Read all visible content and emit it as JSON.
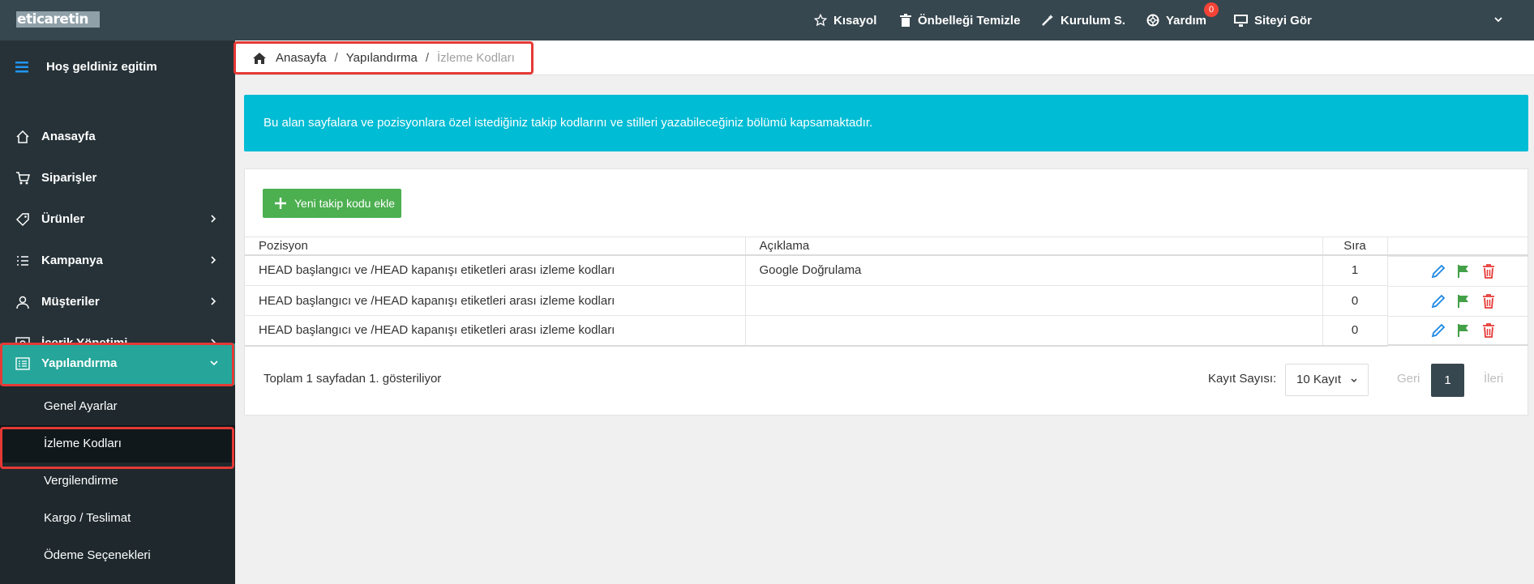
{
  "app": {
    "logo_text": "eticaretin"
  },
  "topbar": {
    "items": [
      {
        "label": "Kısayol",
        "icon": "star-icon"
      },
      {
        "label": "Önbelleği Temizle",
        "icon": "trash-icon"
      },
      {
        "label": "Kurulum S.",
        "icon": "magic-wand-icon"
      },
      {
        "label": "Yardım",
        "icon": "help-lifebuoy-icon",
        "badge": "0"
      },
      {
        "label": "Siteyi Gör",
        "icon": "monitor-icon"
      }
    ]
  },
  "sidebar": {
    "welcome": "Hoş geldiniz egitim",
    "items": [
      {
        "label": "Anasayfa",
        "icon": "home-icon"
      },
      {
        "label": "Siparişler",
        "icon": "cart-icon"
      },
      {
        "label": "Ürünler",
        "icon": "tag-icon"
      },
      {
        "label": "Kampanya",
        "icon": "list-icon"
      },
      {
        "label": "Müşteriler",
        "icon": "user-icon"
      },
      {
        "label": "İçerik Yönetimi",
        "icon": "eye-icon"
      },
      {
        "label": "Yapılandırma",
        "icon": "config-icon"
      }
    ],
    "submenu": [
      "Genel Ayarlar",
      "İzleme Kodları",
      "Vergilendirme",
      "Kargo / Teslimat",
      "Ödeme Seçenekleri"
    ]
  },
  "breadcrumb": {
    "home": "Anasayfa",
    "section": "Yapılandırma",
    "current": "İzleme Kodları"
  },
  "alert": {
    "text": "Bu alan sayfalara ve pozisyonlara özel istediğiniz takip kodlarını ve stilleri yazabileceğiniz bölümü kapsamaktadır."
  },
  "panel": {
    "add_button": "Yeni takip kodu ekle",
    "table": {
      "headers": [
        "Pozisyon",
        "Açıklama",
        "Sıra",
        ""
      ],
      "rows": [
        {
          "pozisyon": "HEAD başlangıcı ve /HEAD kapanışı etiketleri arası izleme kodları",
          "aciklama": "Google Doğrulama",
          "sira": "1"
        },
        {
          "pozisyon": "HEAD başlangıcı ve /HEAD kapanışı etiketleri arası izleme kodları",
          "aciklama": "",
          "sira": "0"
        },
        {
          "pozisyon": "HEAD başlangıcı ve /HEAD kapanışı etiketleri arası izleme kodları",
          "aciklama": "",
          "sira": "0"
        }
      ]
    },
    "footer": {
      "info": "Toplam 1 sayfadan 1. gösteriliyor",
      "page_size_label": "Kayıt Sayısı:",
      "page_size_value": "10 Kayıt",
      "prev": "Geri",
      "current_page": "1",
      "next": "İleri"
    }
  },
  "colors": {
    "topbar": "#37474f",
    "sidebar": "#263238",
    "active": "#26a69a",
    "alert": "#00bcd4",
    "add": "#4caf50",
    "highlight": "#e53935"
  }
}
